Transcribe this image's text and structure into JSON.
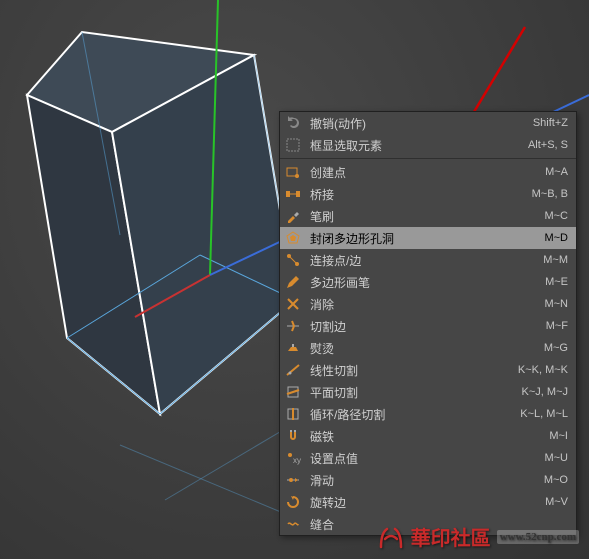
{
  "watermark": {
    "text": "華印社區",
    "url": "www.52cnp.com"
  },
  "menu": {
    "highlighted_index": 5,
    "items": [
      {
        "label": "撤销(动作)",
        "shortcut": "Shift+Z",
        "icon": "undo-icon",
        "type": "item"
      },
      {
        "label": "框显选取元素",
        "shortcut": "Alt+S, S",
        "icon": "frame-icon",
        "type": "item"
      },
      {
        "type": "sep"
      },
      {
        "label": "创建点",
        "shortcut": "M~A",
        "icon": "create-point-icon",
        "type": "item"
      },
      {
        "label": "桥接",
        "shortcut": "M~B, B",
        "icon": "bridge-icon",
        "type": "item"
      },
      {
        "label": "笔刷",
        "shortcut": "M~C",
        "icon": "brush-icon",
        "type": "item"
      },
      {
        "label": "封闭多边形孔洞",
        "shortcut": "M~D",
        "icon": "close-hole-icon",
        "type": "item"
      },
      {
        "label": "连接点/边",
        "shortcut": "M~M",
        "icon": "connect-icon",
        "type": "item"
      },
      {
        "label": "多边形画笔",
        "shortcut": "M~E",
        "icon": "polypen-icon",
        "type": "item"
      },
      {
        "label": "消除",
        "shortcut": "M~N",
        "icon": "dissolve-icon",
        "type": "item"
      },
      {
        "label": "切割边",
        "shortcut": "M~F",
        "icon": "edge-cut-icon",
        "type": "item"
      },
      {
        "label": "熨烫",
        "shortcut": "M~G",
        "icon": "iron-icon",
        "type": "item"
      },
      {
        "label": "线性切割",
        "shortcut": "K~K, M~K",
        "icon": "line-cut-icon",
        "type": "item"
      },
      {
        "label": "平面切割",
        "shortcut": "K~J, M~J",
        "icon": "plane-cut-icon",
        "type": "item"
      },
      {
        "label": "循环/路径切割",
        "shortcut": "K~L, M~L",
        "icon": "loop-cut-icon",
        "type": "item"
      },
      {
        "label": "磁铁",
        "shortcut": "M~I",
        "icon": "magnet-icon",
        "type": "item"
      },
      {
        "label": "设置点值",
        "shortcut": "M~U",
        "icon": "set-point-icon",
        "type": "item"
      },
      {
        "label": "滑动",
        "shortcut": "M~O",
        "icon": "slide-icon",
        "type": "item"
      },
      {
        "label": "旋转边",
        "shortcut": "M~V",
        "icon": "spin-edge-icon",
        "type": "item"
      },
      {
        "label": "缝合",
        "shortcut": "",
        "icon": "stitch-icon",
        "type": "item"
      }
    ]
  }
}
